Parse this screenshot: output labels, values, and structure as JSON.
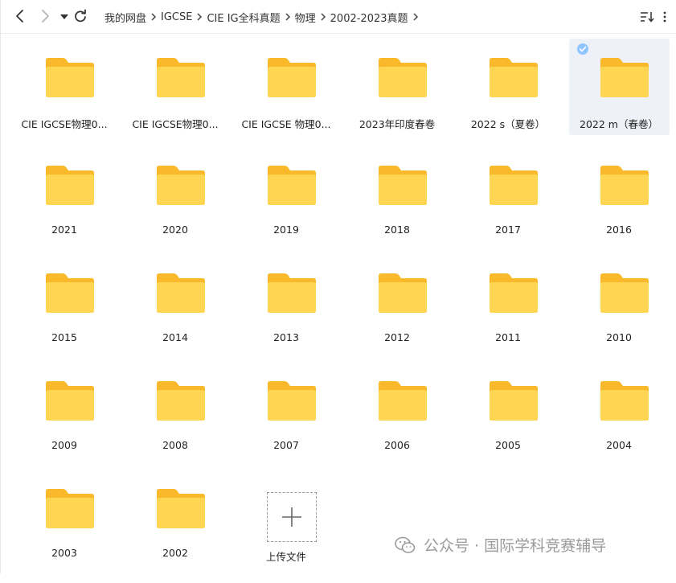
{
  "toolbar": {
    "back_icon": "chevron-left-icon",
    "forward_icon": "chevron-right-icon",
    "history_icon": "caret-down-icon",
    "refresh_icon": "refresh-icon",
    "sort_icon": "sort-icon",
    "more_icon": "more-vertical-icon"
  },
  "breadcrumb": [
    "我的网盘",
    "IGCSE",
    "CIE IG全科真题",
    "物理",
    "2002-2023真题"
  ],
  "folders": [
    {
      "name": "CIE IGCSE物理0..."
    },
    {
      "name": "CIE IGCSE物理0..."
    },
    {
      "name": "CIE IGCSE 物理0..."
    },
    {
      "name": "2023年印度春卷"
    },
    {
      "name": "2022 s（夏卷）"
    },
    {
      "name": "2022 m（春卷）",
      "selected": true
    },
    {
      "name": "2021"
    },
    {
      "name": "2020"
    },
    {
      "name": "2019"
    },
    {
      "name": "2018"
    },
    {
      "name": "2017"
    },
    {
      "name": "2016"
    },
    {
      "name": "2015"
    },
    {
      "name": "2014"
    },
    {
      "name": "2013"
    },
    {
      "name": "2012"
    },
    {
      "name": "2011"
    },
    {
      "name": "2010"
    },
    {
      "name": "2009"
    },
    {
      "name": "2008"
    },
    {
      "name": "2007"
    },
    {
      "name": "2006"
    },
    {
      "name": "2005"
    },
    {
      "name": "2004"
    },
    {
      "name": "2003"
    },
    {
      "name": "2002"
    }
  ],
  "upload": {
    "label": "上传文件",
    "icon": "plus-icon"
  },
  "watermark": {
    "text": "公众号 · 国际学科竞赛辅导",
    "icon": "wechat-icon"
  },
  "colors": {
    "folder_back": "#f9b92a",
    "folder_front": "#ffd552",
    "selected_bg": "#eef1f7",
    "check": "#8ec5ff"
  }
}
